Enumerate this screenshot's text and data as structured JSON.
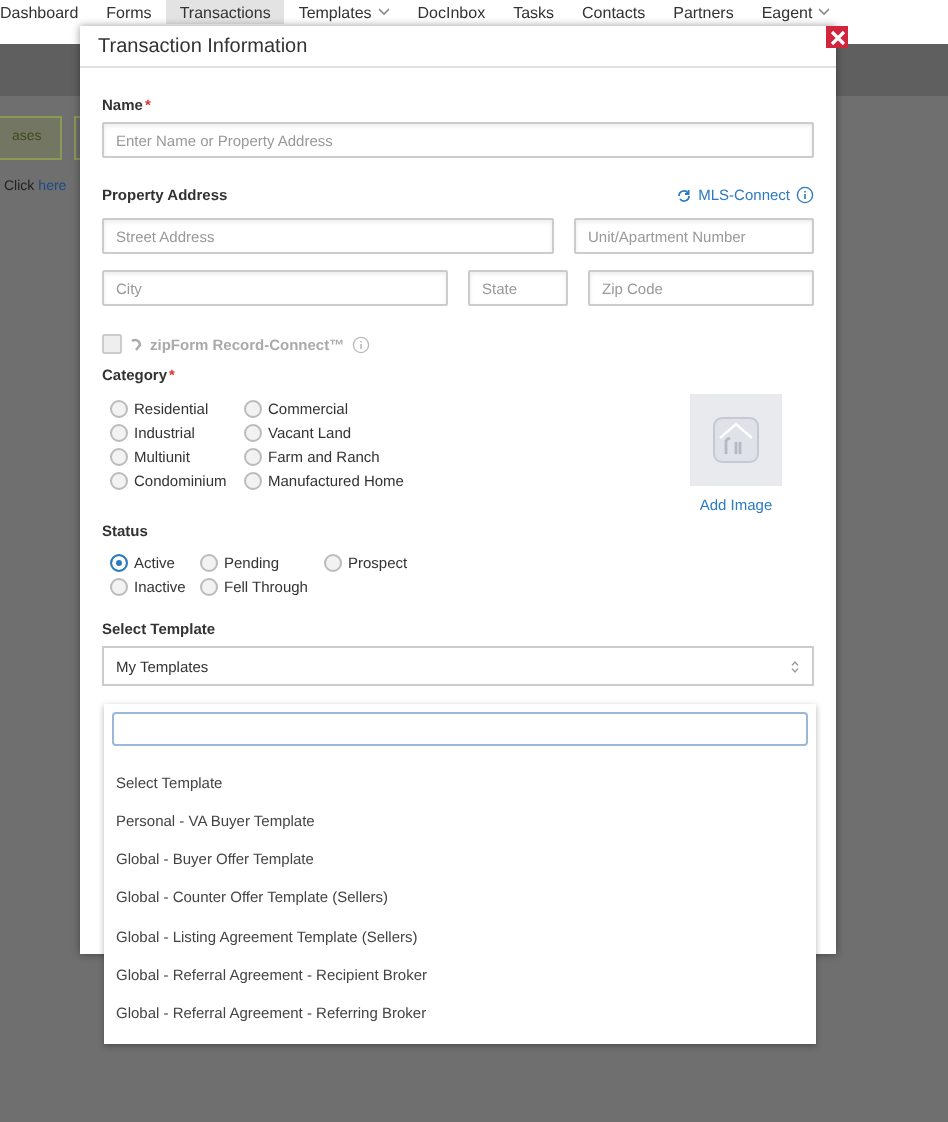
{
  "nav": {
    "items": [
      {
        "label": "Dashboard",
        "selected": false,
        "dropdown": false
      },
      {
        "label": "Forms",
        "selected": false,
        "dropdown": false
      },
      {
        "label": "Transactions",
        "selected": true,
        "dropdown": false
      },
      {
        "label": "Templates",
        "selected": false,
        "dropdown": true
      },
      {
        "label": "DocInbox",
        "selected": false,
        "dropdown": false
      },
      {
        "label": "Tasks",
        "selected": false,
        "dropdown": false
      },
      {
        "label": "Contacts",
        "selected": false,
        "dropdown": false
      },
      {
        "label": "Partners",
        "selected": false,
        "dropdown": false
      },
      {
        "label": "Eagent",
        "selected": false,
        "dropdown": true
      }
    ]
  },
  "background": {
    "button": "ases",
    "text": "Click",
    "link": "here"
  },
  "dialog": {
    "title": "Transaction Information",
    "name": {
      "label": "Name",
      "required_mark": "*",
      "placeholder": "Enter Name or Property Address"
    },
    "address": {
      "label": "Property Address",
      "link": "MLS-Connect",
      "fields": [
        {
          "placeholder": "Street Address"
        },
        {
          "placeholder": "Unit/Apartment Number"
        },
        {
          "placeholder": "City"
        },
        {
          "placeholder": "State"
        },
        {
          "placeholder": "Zip Code"
        }
      ]
    },
    "record_connect": {
      "label": "zipForm Record-Connect™",
      "checked": false,
      "disabled": true
    },
    "category": {
      "label": "Category",
      "required_mark": "*",
      "options": [
        {
          "label": "Residential",
          "selected": false
        },
        {
          "label": "Commercial",
          "selected": false
        },
        {
          "label": "Industrial",
          "selected": false
        },
        {
          "label": "Vacant Land",
          "selected": false
        },
        {
          "label": "Multiunit",
          "selected": false
        },
        {
          "label": "Farm and Ranch",
          "selected": false
        },
        {
          "label": "Condominium",
          "selected": false
        },
        {
          "label": "Manufactured Home",
          "selected": false
        }
      ]
    },
    "image": {
      "link": "Add Image"
    },
    "status": {
      "label": "Status",
      "options": [
        {
          "label": "Active",
          "selected": true
        },
        {
          "label": "Pending",
          "selected": false
        },
        {
          "label": "Prospect",
          "selected": false
        },
        {
          "label": "Inactive",
          "selected": false
        },
        {
          "label": "Fell Through",
          "selected": false
        }
      ]
    },
    "template": {
      "label": "Select Template",
      "value": "My Templates",
      "options": [
        {
          "label": "Select Template"
        },
        {
          "label": "Personal - VA Buyer Template"
        },
        {
          "label": "Global - Buyer Offer Template"
        },
        {
          "label": "Global - Counter Offer Template (Sellers)"
        },
        {
          "label": "Global - Listing Agreement Template (Sellers)"
        },
        {
          "label": "Global - Referral Agreement - Recipient Broker"
        },
        {
          "label": "Global - Referral Agreement - Referring Broker"
        }
      ]
    }
  }
}
